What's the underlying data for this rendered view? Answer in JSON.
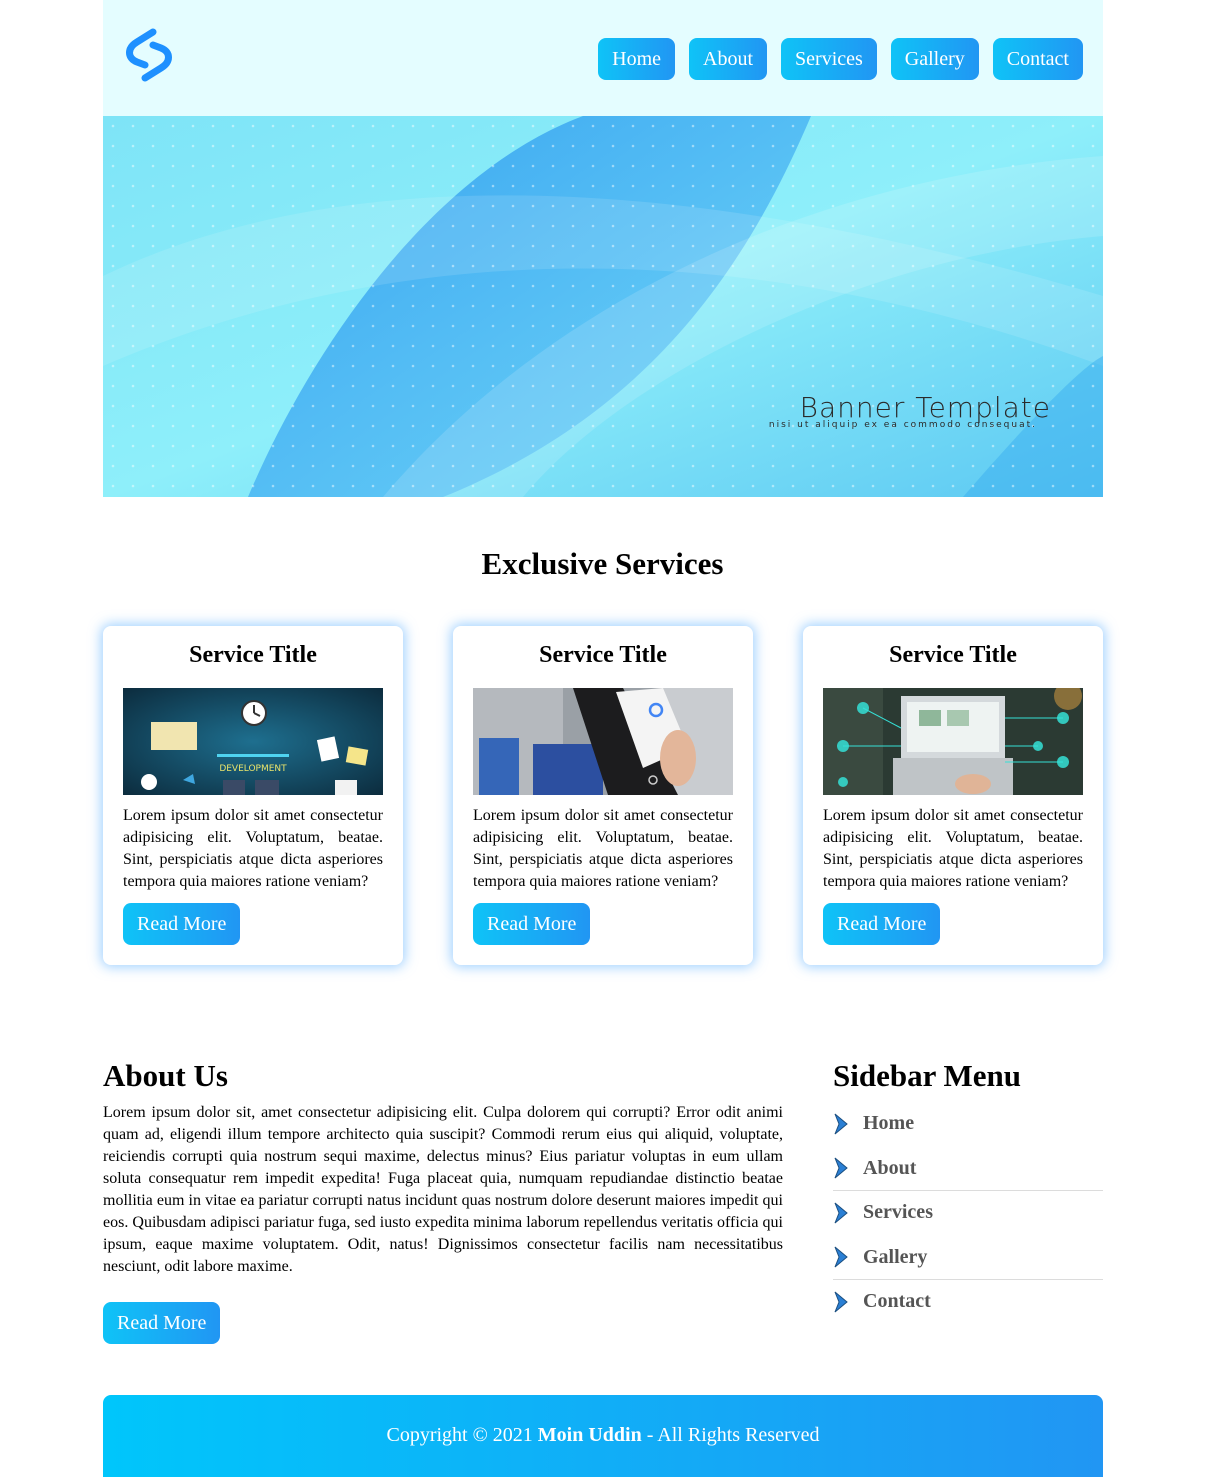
{
  "nav": {
    "items": [
      "Home",
      "About",
      "Services",
      "Gallery",
      "Contact"
    ]
  },
  "banner": {
    "title": "Banner Template",
    "subtitle": "nisi ut aliquip ex ea commodo consequat."
  },
  "services": {
    "heading": "Exclusive Services",
    "cards": [
      {
        "title": "Service Title",
        "text": "Lorem ipsum dolor sit amet consectetur adipisicing elit. Voluptatum, beatae. Sint, perspiciatis atque dicta asperiores tempora quia maiores ratione veniam?",
        "button": "Read More",
        "image_text": "DEVELOPMENT"
      },
      {
        "title": "Service Title",
        "text": "Lorem ipsum dolor sit amet consectetur adipisicing elit. Voluptatum, beatae. Sint, perspiciatis atque dicta asperiores tempora quia maiores ratione veniam?",
        "button": "Read More"
      },
      {
        "title": "Service Title",
        "text": "Lorem ipsum dolor sit amet consectetur adipisicing elit. Voluptatum, beatae. Sint, perspiciatis atque dicta asperiores tempora quia maiores ratione veniam?",
        "button": "Read More"
      }
    ]
  },
  "about": {
    "heading": "About Us",
    "text": "Lorem ipsum dolor sit, amet consectetur adipisicing elit. Culpa dolorem qui corrupti? Error odit animi quam ad, eligendi illum tempore architecto quia suscipit? Commodi rerum eius qui aliquid, voluptate, reiciendis corrupti quia nostrum sequi maxime, delectus minus? Eius pariatur voluptas in eum ullam soluta consequatur rem impedit expedita! Fuga placeat quia, numquam repudiandae distinctio beatae mollitia eum in vitae ea pariatur corrupti natus incidunt quas nostrum dolore deserunt maiores impedit qui eos. Quibusdam adipisci pariatur fuga, sed iusto expedita minima laborum repellendus veritatis officia qui ipsum, eaque maxime voluptatem. Odit, natus! Dignissimos consectetur facilis nam necessitatibus nesciunt, odit labore maxime.",
    "button": "Read More"
  },
  "sidebar": {
    "heading": "Sidebar Menu",
    "items": [
      "Home",
      "About",
      "Services",
      "Gallery",
      "Contact"
    ]
  },
  "footer": {
    "prefix": "Copyright © 2021",
    "name": "Moin Uddin",
    "suffix": "- All Rights Reserved"
  },
  "colors": {
    "accent_start": "#0fc3f7",
    "accent_end": "#2196f3",
    "header_bg": "#e4fdff"
  }
}
